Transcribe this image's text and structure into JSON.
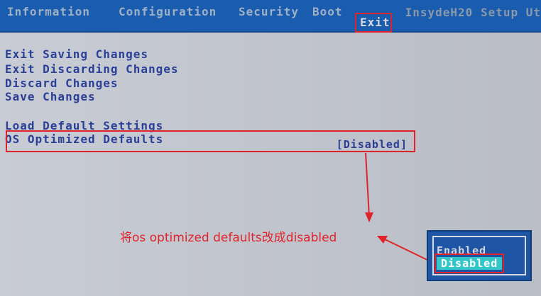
{
  "topbar": {
    "tabs": [
      {
        "label": "Information"
      },
      {
        "label": "Configuration"
      },
      {
        "label": "Security"
      },
      {
        "label": "Boot"
      },
      {
        "label": "Exit"
      }
    ],
    "brand": "InsydeH20 Setup Ut"
  },
  "menu": {
    "items": [
      {
        "label": "Exit Saving Changes"
      },
      {
        "label": "Exit Discarding Changes"
      },
      {
        "label": "Discard Changes"
      },
      {
        "label": "Save Changes"
      },
      {
        "label": "Load Default Settings"
      },
      {
        "label": "OS Optimized Defaults",
        "value": "[Disabled]"
      }
    ]
  },
  "annotation": {
    "text": "将os optimized defaults改成disabled"
  },
  "popup": {
    "options": [
      "Enabled",
      "Disabled"
    ],
    "selected": "Disabled"
  },
  "colors": {
    "accent_red": "#e0232b",
    "panel": "#c5c9d2",
    "topbar": "#1a5cae",
    "text_blue": "#2a3f96"
  }
}
